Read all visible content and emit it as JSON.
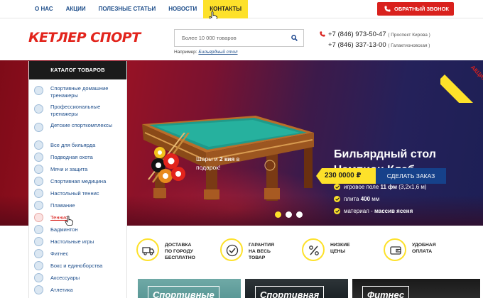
{
  "nav": {
    "items": [
      {
        "label": "О НАС"
      },
      {
        "label": "АКЦИИ"
      },
      {
        "label": "ПОЛЕЗНЫЕ СТАТЬИ"
      },
      {
        "label": "НОВОСТИ"
      },
      {
        "label": "КОНТАКТЫ",
        "active": true
      }
    ],
    "callback_label": "ОБРАТНЫЙ ЗВОНОК"
  },
  "header": {
    "logo": "КЕТЛЕР СПОРТ",
    "search": {
      "placeholder": "Более 10 000 товаров",
      "hint_prefix": "Например:",
      "hint_link": "Бильярдный стол"
    },
    "phones": [
      {
        "number": "+7 (846) 973-50-47",
        "location": "( Проспект Кирова )"
      },
      {
        "number": "+7 (846) 337-13-00",
        "location": "( Галактионовская )"
      }
    ]
  },
  "catalog": {
    "title": "КАТАЛОГ ТОВАРОВ",
    "items": [
      {
        "label": "Спортивные домашние тренажеры",
        "icon": "treadmill-icon"
      },
      {
        "label": "Профессиональные тренажеры",
        "icon": "gym-machine-icon"
      },
      {
        "label": "Детские спорткомплексы",
        "icon": "bicycle-icon"
      },
      {
        "label": "Все для бильярда",
        "icon": "billiard-ball-icon"
      },
      {
        "label": "Подводная охота",
        "icon": "diving-icon"
      },
      {
        "label": "Мячи и защита",
        "icon": "ball-icon"
      },
      {
        "label": "Спортивная медицина",
        "icon": "medicine-icon"
      },
      {
        "label": "Настольный теннис",
        "icon": "table-tennis-icon"
      },
      {
        "label": "Плавание",
        "icon": "swimming-icon"
      },
      {
        "label": "Теннис",
        "icon": "tennis-icon",
        "active": true
      },
      {
        "label": "Бадминтон",
        "icon": "badminton-icon"
      },
      {
        "label": "Настольные игры",
        "icon": "board-game-icon"
      },
      {
        "label": "Фитнес",
        "icon": "fitness-icon"
      },
      {
        "label": "Бокс и единоборства",
        "icon": "boxing-icon"
      },
      {
        "label": "Аксессуары",
        "icon": "accessories-icon"
      },
      {
        "label": "Атлетика",
        "icon": "athletics-icon"
      }
    ]
  },
  "hero": {
    "balls_text": "Шары и 2 кия в подарок!",
    "balls_text_pre": "Шары и ",
    "balls_text_bold": "2 кия",
    "balls_text_post": " в подарок!",
    "title": "Бильярдный стол Чемпион Клаб",
    "features": [
      {
        "pre": "игровое поле ",
        "bold": "11 фм",
        "post": " (3,2х1,6 м)"
      },
      {
        "pre": "плита ",
        "bold": "400",
        "post": " мм"
      },
      {
        "pre": "материал - ",
        "bold": "массив ясеня",
        "post": ""
      }
    ],
    "price": "230 0000 ₽",
    "order_label": "СДЕЛАТЬ ЗАКАЗ",
    "promo": "АКЦИЯ",
    "slides_count": 3,
    "active_slide": 0,
    "colors": {
      "accent": "#fde12a",
      "brand_red": "#e2241c",
      "button_blue": "#16418a"
    }
  },
  "advantages": [
    {
      "text": "ДОСТАВКА\nПО ГОРОДУ\nБЕСПЛАТНО",
      "icon": "delivery-truck-icon"
    },
    {
      "text": "ГАРАНТИЯ\nНА ВЕСЬ\nТОВАР",
      "icon": "checkmark-icon"
    },
    {
      "text": "НИЗКИЕ\nЦЕНЫ",
      "icon": "percent-icon"
    },
    {
      "text": "УДОБНАЯ\nОПЛАТА",
      "icon": "wallet-icon"
    }
  ],
  "cards": [
    {
      "label": "Спортивные"
    },
    {
      "label": "Спортивная"
    },
    {
      "label": "Фитнес"
    }
  ]
}
